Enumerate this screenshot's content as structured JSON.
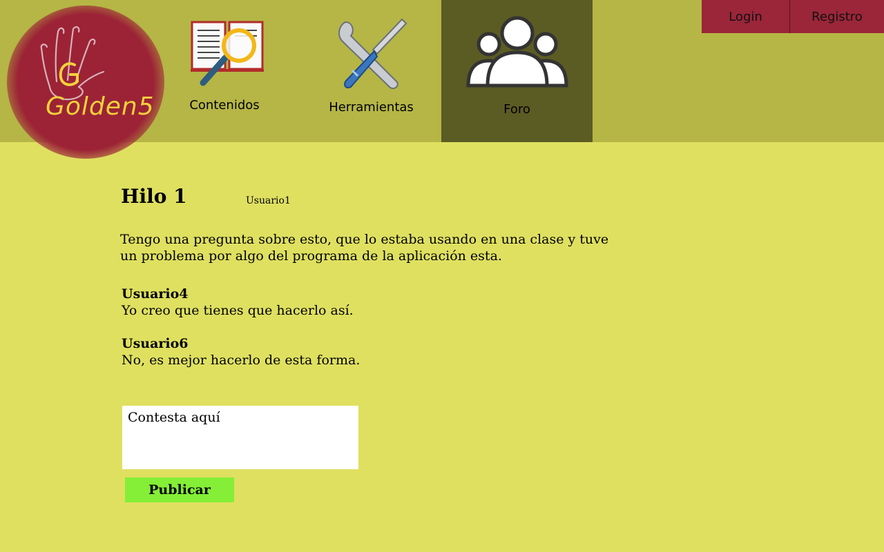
{
  "brand": {
    "logo_text": "Golden5",
    "logo_letter": "G"
  },
  "nav": {
    "items": [
      {
        "label": "Contenidos",
        "icon": "book-magnifier-icon"
      },
      {
        "label": "Herramientas",
        "icon": "tools-icon"
      },
      {
        "label": "Foro",
        "icon": "users-group-icon",
        "active": true
      }
    ]
  },
  "auth": {
    "login_label": "Login",
    "register_label": "Registro"
  },
  "thread": {
    "title": "Hilo 1",
    "author": "Usuario1",
    "body": "Tengo una pregunta sobre esto, que lo estaba usando en una clase y tuve un problema por algo del programa de la aplicación esta."
  },
  "replies": [
    {
      "user": "Usuario4",
      "text": "Yo creo que tienes que hacerlo así."
    },
    {
      "user": "Usuario6",
      "text": "No, es mejor hacerlo de esta forma."
    }
  ],
  "reply_form": {
    "placeholder": "Contesta aquí",
    "value": "",
    "submit_label": "Publicar"
  },
  "colors": {
    "page_bg": "#dfe060",
    "header_bg": "#b5b645",
    "active_nav_bg": "#5b5b24",
    "brand_red": "#9b2539",
    "publish_green": "#84ef36"
  }
}
